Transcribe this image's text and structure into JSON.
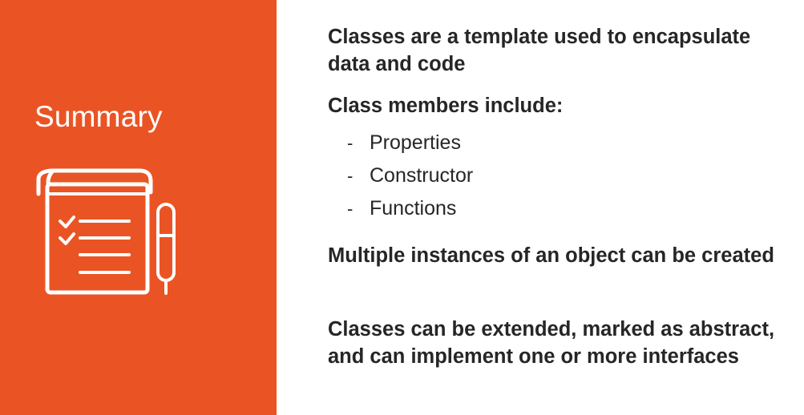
{
  "sidebar": {
    "title": "Summary",
    "accent_color": "#ea5424",
    "illustration": {
      "icon_name": "checklist-scroll-with-pen",
      "color": "#ffffff"
    }
  },
  "main": {
    "points": [
      {
        "text": "Classes are a template used to encapsulate data and code"
      },
      {
        "text": "Class members include:",
        "subitems": [
          {
            "marker": "-",
            "text": "Properties"
          },
          {
            "marker": "-",
            "text": "Constructor"
          },
          {
            "marker": "-",
            "text": "Functions"
          }
        ]
      },
      {
        "text": "Multiple instances of an object can be created"
      },
      {
        "text": "Classes can be extended, marked as abstract, and can implement one or more interfaces"
      }
    ]
  }
}
